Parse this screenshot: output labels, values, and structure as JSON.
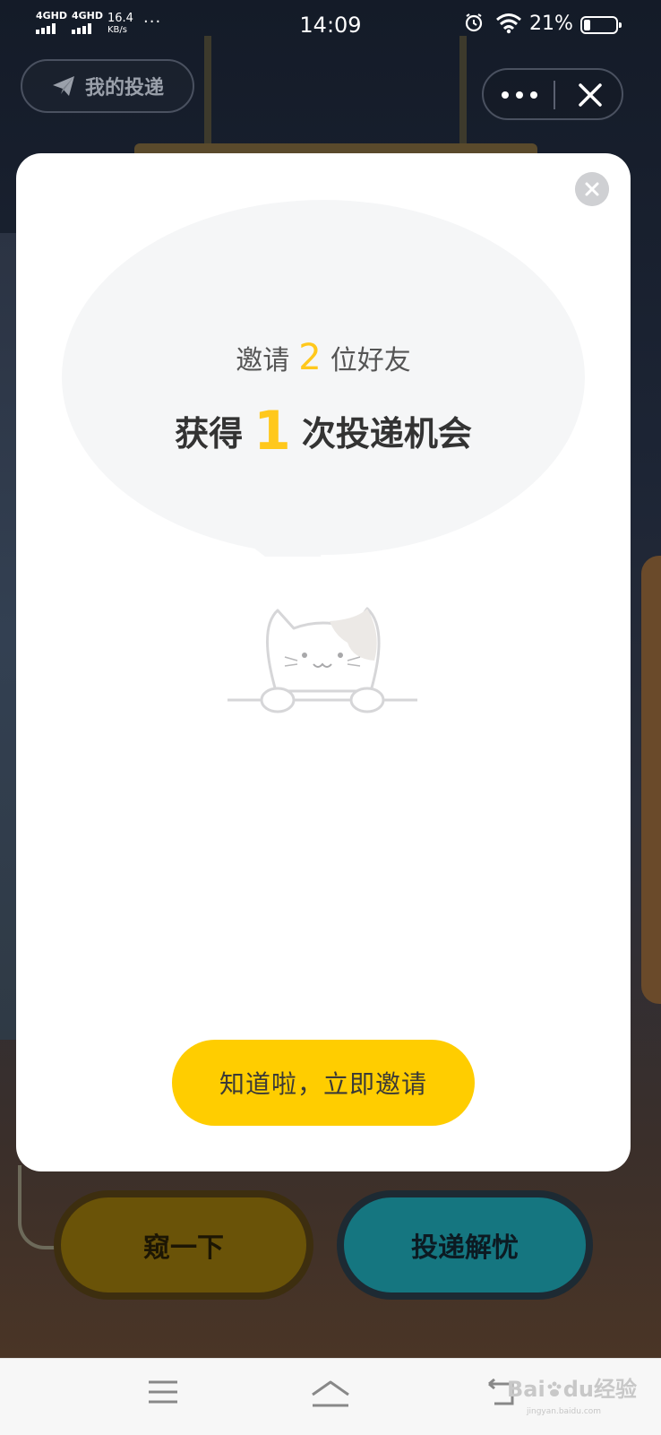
{
  "status_bar": {
    "sim1": "4GHD",
    "sim2": "4GHD",
    "speed_value": "16.4",
    "speed_unit": "KB/s",
    "overflow": "···",
    "time": "14:09",
    "battery_percent": "21%",
    "battery_level": 0.21
  },
  "top_bar": {
    "my_deliveries_label": "我的投递"
  },
  "modal": {
    "line1_prefix": "邀请",
    "line1_number": "2",
    "line1_suffix": "位好友",
    "line2_prefix": "获得",
    "line2_number": "1",
    "line2_suffix": "次投递机会",
    "cta_label": "知道啦，立即邀请"
  },
  "game_buttons": {
    "peek_label": "窥一下",
    "post_label": "投递解忧"
  },
  "watermark": {
    "brand_a": "Bai",
    "brand_b": "du",
    "brand_c": "经验",
    "domain": "jingyan.baidu.com"
  },
  "colors": {
    "accent_yellow": "#ffcd00",
    "number_yellow": "#ffc81c",
    "teal": "#157680"
  }
}
